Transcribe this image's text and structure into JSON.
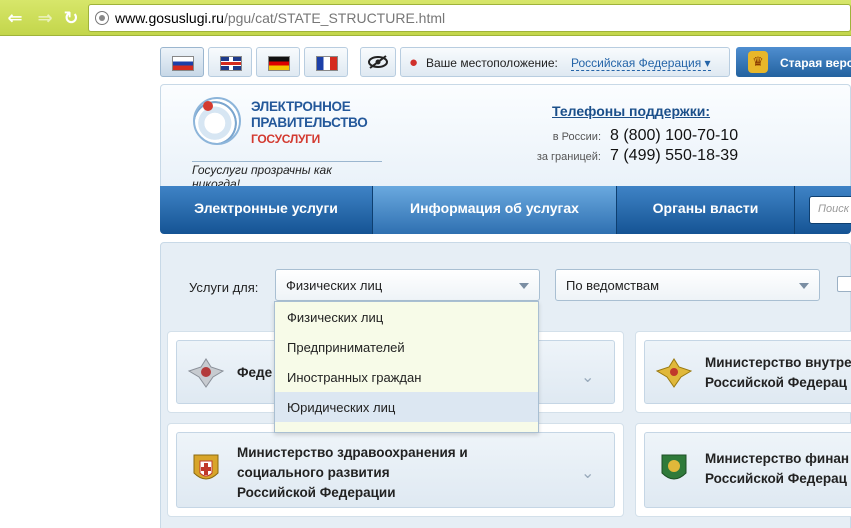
{
  "browser": {
    "back_glyph": "⇐",
    "forward_glyph": "⇒",
    "reload_glyph": "↻",
    "url_host": "www.gosuslugi.ru",
    "url_path": "/pgu/cat/STATE_STRUCTURE.html"
  },
  "lang_bar": {
    "languages": [
      "ru",
      "en",
      "de",
      "fr"
    ],
    "location_label": "Ваше местоположение:",
    "location_value": "Российская Федерация ▾",
    "old_version_label": "Старая верс"
  },
  "header": {
    "logo_line1": "ЭЛЕКТРОННОЕ",
    "logo_line2": "ПРАВИТЕЛЬСТВО",
    "logo_line3": "ГОСУСЛУГИ",
    "tagline": "Госуслуги прозрачны как никогда!",
    "support_title": "Телефоны поддержки:",
    "support_russia_label": "в России:",
    "support_russia_phone": "8 (800) 100-70-10",
    "support_abroad_label": "за границей:",
    "support_abroad_phone": "7 (499) 550-18-39"
  },
  "menu": {
    "items": [
      {
        "label": "Электронные услуги"
      },
      {
        "label": "Информация об услугах"
      },
      {
        "label": "Органы власти"
      }
    ],
    "search_placeholder": "Поиск"
  },
  "filters": {
    "services_for_label": "Услуги для:",
    "services_for_selected": "Физических лиц",
    "group_by_selected": "По ведомствам"
  },
  "dropdown": {
    "options": [
      "Физических лиц",
      "Предпринимателей",
      "Иностранных граждан",
      "Юридических лиц"
    ],
    "highlighted": "Юридических лиц"
  },
  "cards": {
    "card1_line1": "Феде",
    "card2_line1": "Министерство внутре",
    "card2_line2": "Российской Федерац",
    "card3_line1": "Министерство здравоохранения и",
    "card3_line2": "социального развития",
    "card3_line3": "Российской Федерации",
    "card4_line1": "Министерство финан",
    "card4_line2": "Российской Федерац"
  },
  "colors": {
    "chrome": "#c8da50",
    "menu_blue": "#1f5fa0",
    "dropdown_bg": "#f7fbe8",
    "link": "#2464a8"
  }
}
